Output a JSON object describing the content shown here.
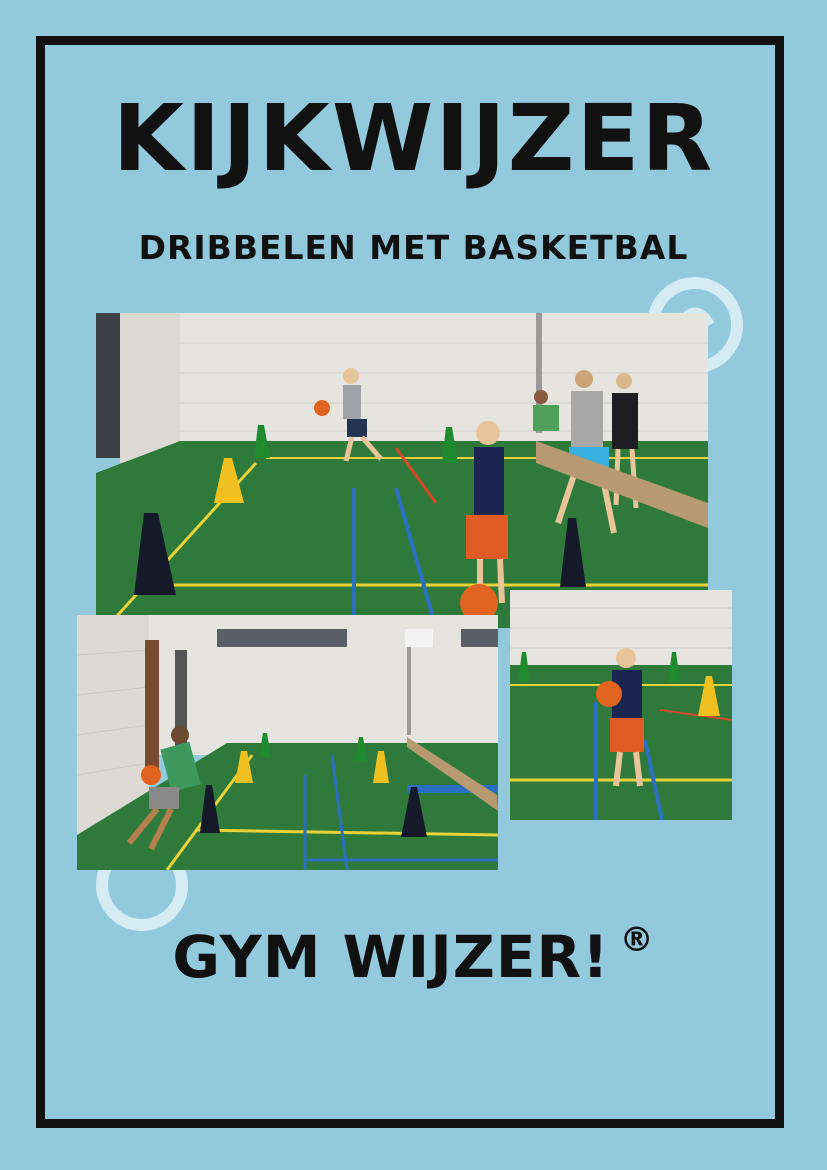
{
  "title": "KIJKWIJZER",
  "subtitle": "DRIBBELEN MET BASKETBAL",
  "brand": {
    "name": "GYM WIJZER!",
    "mark": "®"
  },
  "photos": [
    {
      "subject": "boy-dribbling-between-cones"
    },
    {
      "subject": "child-dribbling-ball-low"
    },
    {
      "subject": "boy-dribbling-sprint-in-gym"
    }
  ],
  "colors": {
    "background": "#92c9dc",
    "border": "#111111",
    "floor": "#2e7d3c",
    "wall": "#e4e2dc",
    "ball": "#e0641f",
    "cone_dark": "#151a2a",
    "cone_yellow": "#f0c020",
    "cone_green": "#1f8a2e"
  }
}
